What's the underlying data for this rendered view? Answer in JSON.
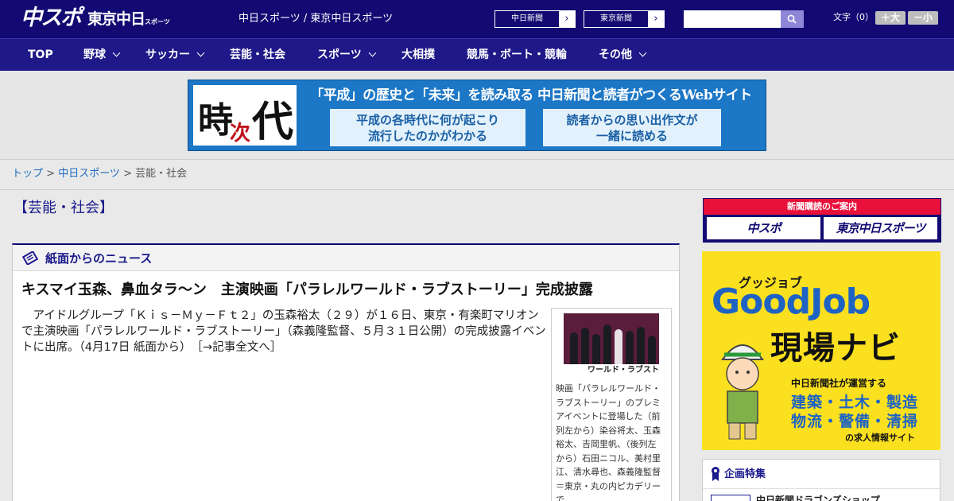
{
  "header": {
    "logo_chunichi_sports": "中スポ",
    "logo_tokyo_chunichi": "東京中日",
    "logo_tokyo_chunichi_sub": "スポーツ",
    "site_title": "中日スポーツ / 東京中日スポーツ",
    "paper_links": [
      "中日新聞",
      "東京新聞"
    ],
    "search_placeholder": "",
    "font_size_label": "文字（0）",
    "font_larger": "＋大",
    "font_smaller": "－小"
  },
  "nav": {
    "items": [
      {
        "label": "TOP",
        "has_dropdown": false
      },
      {
        "label": "野球",
        "has_dropdown": true
      },
      {
        "label": "サッカー",
        "has_dropdown": true
      },
      {
        "label": "芸能・社会",
        "has_dropdown": false
      },
      {
        "label": "スポーツ",
        "has_dropdown": true
      },
      {
        "label": "大相撲",
        "has_dropdown": false
      },
      {
        "label": "競馬・ボート・競輪",
        "has_dropdown": false
      },
      {
        "label": "その他",
        "has_dropdown": true
      }
    ]
  },
  "banner": {
    "calligraphy_1": "時",
    "calligraphy_2": "次",
    "calligraphy_3": "代",
    "headline": "「平成」の歴史と「未来」を読み取る 中日新聞と読者がつくるWebサイト",
    "box_left_line1": "平成の各時代に何が起こり",
    "box_left_line2": "流行したのかがわかる",
    "box_right_line1": "読者からの思い出作文が",
    "box_right_line2": "一緒に読める"
  },
  "breadcrumb": {
    "home": "トップ",
    "sep1": " > ",
    "section": "中日スポーツ",
    "sep2": " > ",
    "current": "芸能・社会"
  },
  "page": {
    "heading": "【芸能・社会】"
  },
  "news_panel": {
    "title": "紙面からのニュース",
    "article_title": "キスマイ玉森、鼻血タラ～ン　主演映画「パラレルワールド・ラブストーリー」完成披露",
    "article_body": "　アイドルグループ「Ｋｉｓ－Ｍｙ－Ｆｔ２」の玉森裕太（２９）が１６日、東京・有楽町マリオンで主演映画「パラレルワールド・ラブストーリー」（森義隆監督、５月３１日公開）の完成披露イベントに出席。（4月17日 紙面から）",
    "read_more": "［→記事全文へ］",
    "photo_strip_text": "ワールド・ラブスト",
    "photo_caption": "映画「パラレルワールド・ラブストーリー」のプレミアイベントに登場した（前列左から）染谷将太、玉森裕太、吉岡里帆、（後列左から）石田ニコル、美村里江、清水尋也、森義隆監督＝東京・丸の内ピカデリーで"
  },
  "sidebar": {
    "subscription_label": "新聞購読のご案内",
    "subscription_buttons": [
      "中スポ",
      "東京中日スポーツ"
    ],
    "ad": {
      "kana": "グッジョブ",
      "brand": "GoodJob",
      "name": "現場ナビ",
      "operator": "中日新聞社が運営する",
      "categories_line1": "建築・土木・製造",
      "categories_line2": "物流・警備・清掃",
      "footer": "の求人情報サイト"
    },
    "feature_title": "企画特集",
    "feature_item": "中日新聞ドラゴンズショップ"
  },
  "colors": {
    "header_bg": "#120a72",
    "nav_bg": "#1e1888",
    "link": "#1c6bc0",
    "heading": "#1a1a8c",
    "ad_yellow": "#fbe01f",
    "ad_blue": "#1e63c3",
    "subscription_red": "#e8103a"
  }
}
